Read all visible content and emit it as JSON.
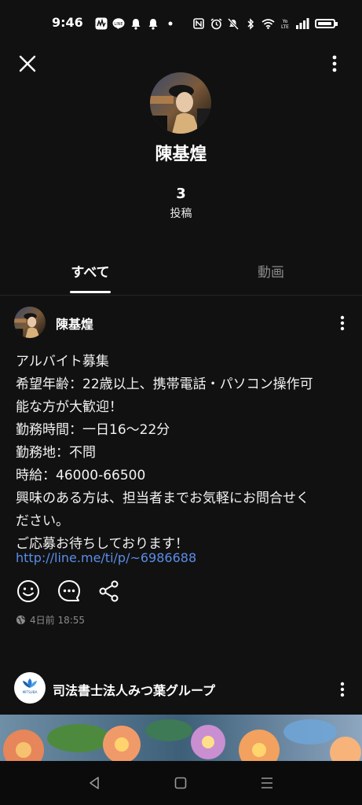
{
  "status_bar": {
    "time": "9:46"
  },
  "profile": {
    "name": "陳基煌",
    "post_count": "3",
    "post_count_label": "投稿"
  },
  "tabs": [
    {
      "label": "すべて",
      "selected": true
    },
    {
      "label": "動画",
      "selected": false
    }
  ],
  "post1": {
    "author": "陳基煌",
    "lines": [
      "アルバイト募集",
      "希望年齢：22歳以上、携帯電話・パソコン操作可",
      "能な方が大歓迎！",
      "勤務時間：一日16〜22分",
      "勤務地：不問",
      "時給：46000-66500",
      "興味のある方は、担当者までお気軽にお問合せく",
      "ださい。",
      "ご応募お待ちしております！"
    ],
    "link": "http://line.me/ti/p/~6986688",
    "timestamp": "4日前 18:55"
  },
  "post2": {
    "author": "司法書士法人みつ葉グループ",
    "logo_text": "MITSUBA"
  },
  "icons": {
    "close": "close-icon",
    "more": "more-vertical-icon",
    "react": "smiley-icon",
    "comment": "comment-icon",
    "share": "share-icon",
    "globe": "globe-icon",
    "nav_back": "back-triangle-icon",
    "nav_home": "home-square-icon",
    "nav_recent": "recent-apps-icon"
  },
  "colors": {
    "background": "#111111",
    "link": "#5b8de9",
    "muted": "#8a8a8a"
  }
}
